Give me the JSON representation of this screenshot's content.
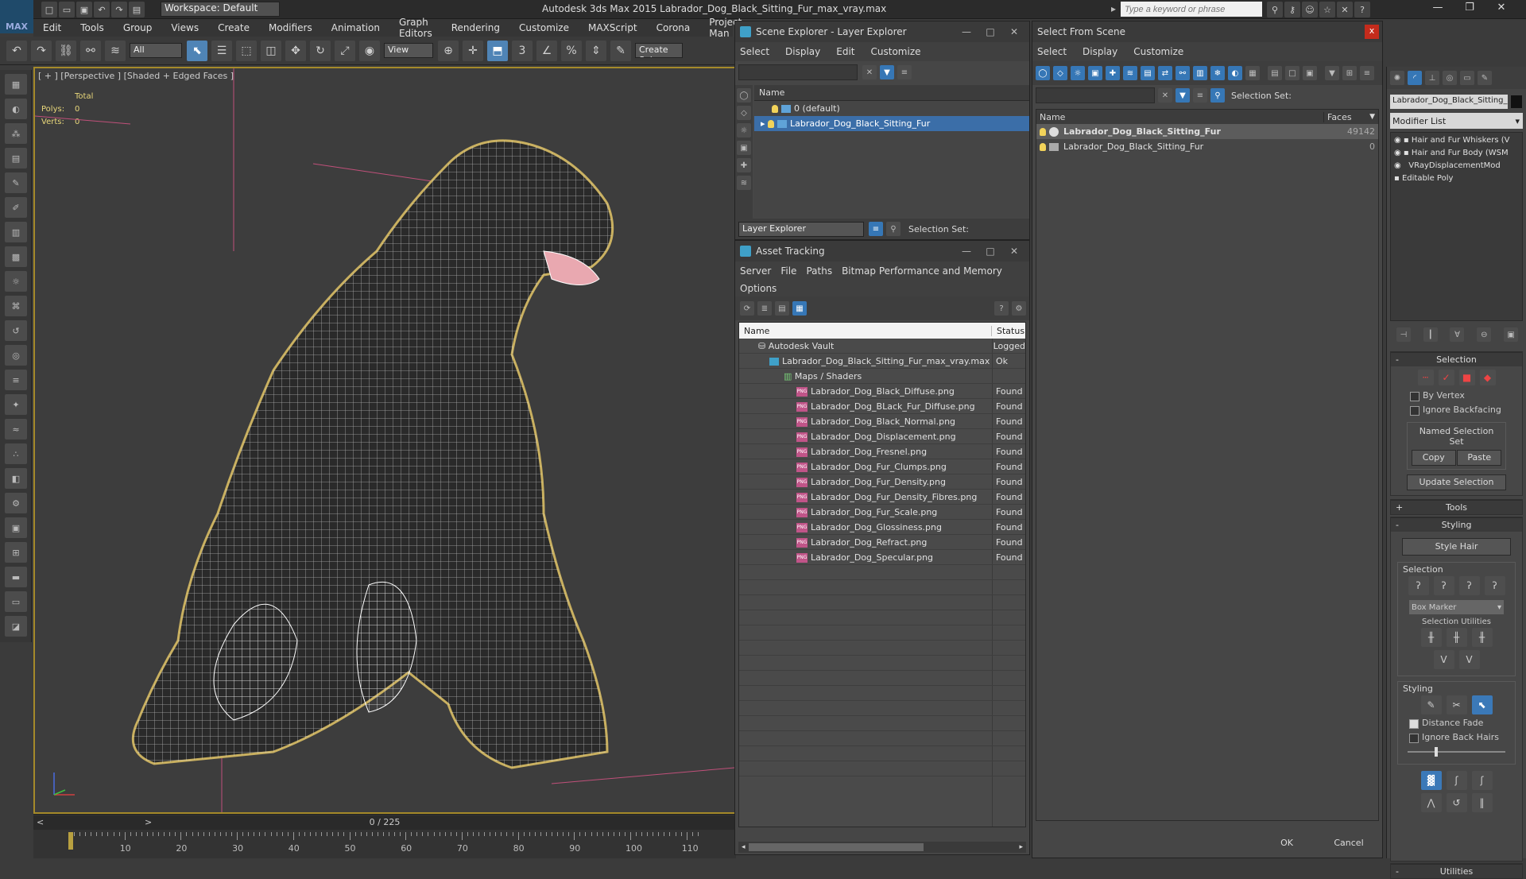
{
  "app": {
    "title": "Autodesk 3ds Max  2015    Labrador_Dog_Black_Sitting_Fur_max_vray.max",
    "logo": "MAX",
    "workspace": "Workspace: Default",
    "search_placeholder": "Type a keyword or phrase"
  },
  "menu": [
    "Edit",
    "Tools",
    "Group",
    "Views",
    "Create",
    "Modifiers",
    "Animation",
    "Graph Editors",
    "Rendering",
    "Customize",
    "MAXScript",
    "Corona",
    "Project Man"
  ],
  "toolbar": {
    "selection_filter": "All",
    "ref_coord": "View",
    "snap_3": "3",
    "create_sel": "Create Selec"
  },
  "viewport": {
    "label": "[ + ] [Perspective ] [Shaded + Edged Faces ]",
    "stats_total": "Total",
    "polys_label": "Polys:",
    "polys_value": "0",
    "verts_label": "Verts:",
    "verts_value": "0"
  },
  "timeline": {
    "frame": "0 / 225",
    "ticks": [
      "10",
      "20",
      "30",
      "40",
      "50",
      "60",
      "70",
      "80",
      "90",
      "100",
      "110"
    ]
  },
  "scene_explorer": {
    "title": "Scene Explorer - Layer Explorer",
    "menu": [
      "Select",
      "Display",
      "Edit",
      "Customize"
    ],
    "col_name": "Name",
    "rows": [
      {
        "name": "0 (default)"
      },
      {
        "name": "Labrador_Dog_Black_Sitting_Fur"
      }
    ],
    "footer_dropdown": "Layer Explorer",
    "footer_selset": "Selection Set:"
  },
  "asset_tracking": {
    "title": "Asset Tracking",
    "menu": [
      "Server",
      "File",
      "Paths",
      "Bitmap Performance and Memory"
    ],
    "menu2": "Options",
    "col_name": "Name",
    "col_status": "Status",
    "vault": {
      "name": "Autodesk Vault",
      "status": "Logged"
    },
    "file": {
      "name": "Labrador_Dog_Black_Sitting_Fur_max_vray.max",
      "status": "Ok"
    },
    "group": "Maps / Shaders",
    "maps": [
      {
        "name": "Labrador_Dog_Black_Diffuse.png",
        "status": "Found"
      },
      {
        "name": "Labrador_Dog_BLack_Fur_Diffuse.png",
        "status": "Found"
      },
      {
        "name": "Labrador_Dog_Black_Normal.png",
        "status": "Found"
      },
      {
        "name": "Labrador_Dog_Displacement.png",
        "status": "Found"
      },
      {
        "name": "Labrador_Dog_Fresnel.png",
        "status": "Found"
      },
      {
        "name": "Labrador_Dog_Fur_Clumps.png",
        "status": "Found"
      },
      {
        "name": "Labrador_Dog_Fur_Density.png",
        "status": "Found"
      },
      {
        "name": "Labrador_Dog_Fur_Density_Fibres.png",
        "status": "Found"
      },
      {
        "name": "Labrador_Dog_Fur_Scale.png",
        "status": "Found"
      },
      {
        "name": "Labrador_Dog_Glossiness.png",
        "status": "Found"
      },
      {
        "name": "Labrador_Dog_Refract.png",
        "status": "Found"
      },
      {
        "name": "Labrador_Dog_Specular.png",
        "status": "Found"
      }
    ],
    "png_badge": "PNG"
  },
  "select_from_scene": {
    "title": "Select From Scene",
    "close": "x",
    "menu": [
      "Select",
      "Display",
      "Customize"
    ],
    "selset": "Selection Set:",
    "col_name": "Name",
    "col_faces": "Faces",
    "rows": [
      {
        "name": "Labrador_Dog_Black_Sitting_Fur",
        "faces": "49142"
      },
      {
        "name": "Labrador_Dog_Black_Sitting_Fur",
        "faces": "0"
      }
    ],
    "ok": "OK",
    "cancel": "Cancel"
  },
  "command_panel": {
    "object_name": "Labrador_Dog_Black_Sitting_",
    "modifier_list": "Modifier List",
    "stack": [
      "Hair and Fur Whiskers (V",
      "Hair and Fur Body (WSM",
      "VRayDisplacementMod",
      "Editable Poly"
    ],
    "selection_header": "Selection",
    "by_vertex": "By Vertex",
    "ignore_backfacing": "Ignore Backfacing",
    "named_sel_set": "Named Selection Set",
    "copy": "Copy",
    "paste": "Paste",
    "update_selection": "Update Selection",
    "tools_header": "Tools",
    "styling_header": "Styling",
    "style_hair": "Style Hair",
    "selection_sub": "Selection",
    "box_marker": "Box Marker",
    "selection_utilities": "Selection Utilities",
    "styling_sub": "Styling",
    "distance_fade": "Distance Fade",
    "ignore_back_hairs": "Ignore Back Hairs",
    "utilities": "Utilities"
  }
}
